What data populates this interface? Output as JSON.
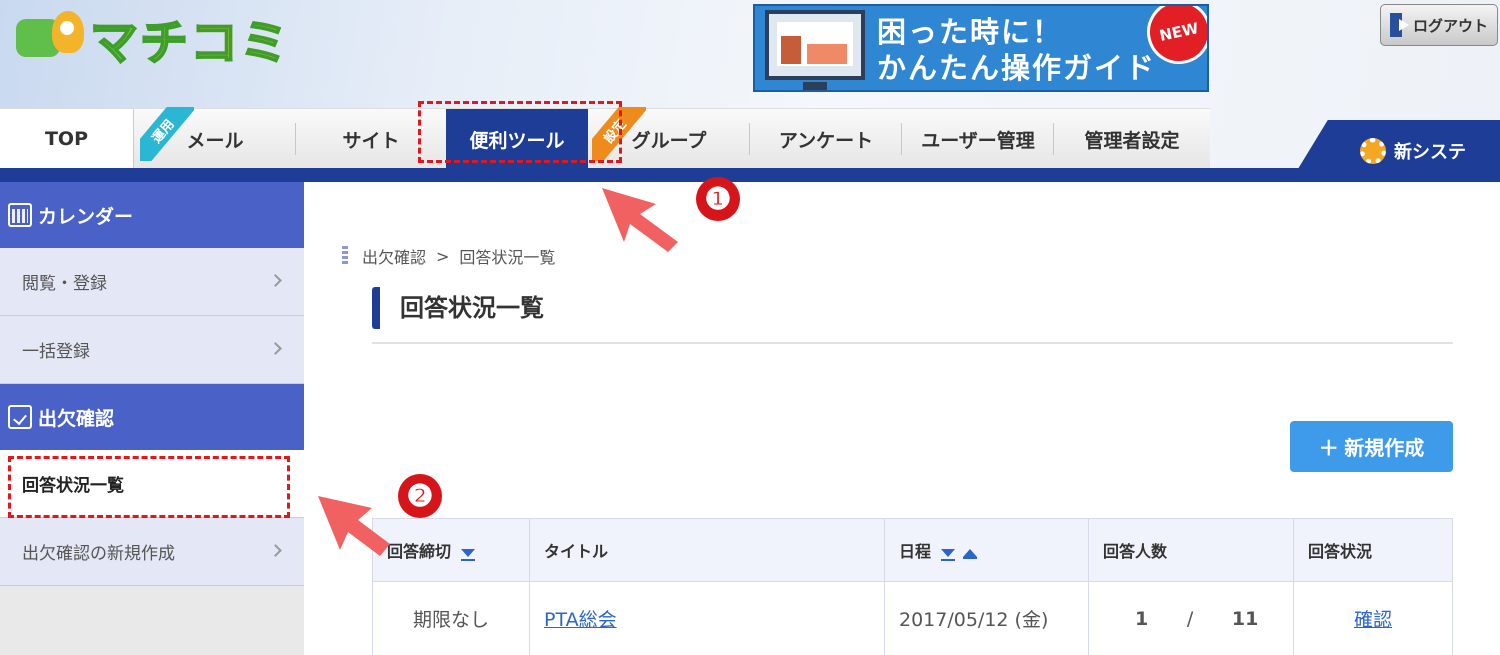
{
  "header": {
    "logo_text": "マチコミ",
    "banner": {
      "line1": "困った時に！",
      "line2": "かんたん操作ガイド",
      "badge": "NEW"
    },
    "logout_label": "ログアウト",
    "new_system_label": "新システ"
  },
  "nav": {
    "tabs": [
      {
        "label": "TOP"
      },
      {
        "label": "メール",
        "ribbon": "運用"
      },
      {
        "label": "サイト"
      },
      {
        "label": "便利ツール",
        "active": true
      },
      {
        "label": "グループ",
        "ribbon": "設定"
      },
      {
        "label": "アンケート"
      },
      {
        "label": "ユーザー管理"
      },
      {
        "label": "管理者設定"
      }
    ]
  },
  "sidebar": {
    "sections": [
      {
        "title": "カレンダー",
        "items": [
          {
            "label": "閲覧・登録"
          },
          {
            "label": "一括登録"
          }
        ]
      },
      {
        "title": "出欠確認",
        "items": [
          {
            "label": "回答状況一覧"
          },
          {
            "label": "出欠確認の新規作成"
          }
        ]
      }
    ]
  },
  "main": {
    "breadcrumb": {
      "parent": "出欠確認",
      "separator": ">",
      "current": "回答状況一覧"
    },
    "page_title": "回答状況一覧",
    "new_button": "＋ 新規作成",
    "table": {
      "headers": [
        "回答締切",
        "タイトル",
        "日程",
        "回答人数",
        "回答状況"
      ],
      "rows": [
        {
          "deadline": "期限なし",
          "title": "PTA総会",
          "date": "2017/05/12 (金)",
          "answered": "1",
          "slash": "/",
          "total": "11",
          "status": "確認"
        }
      ]
    }
  },
  "annotations": {
    "step1": "❶",
    "step2": "❷"
  },
  "colors": {
    "nav_active": "#1e3d96",
    "sidebar_header": "#4a62c8",
    "button": "#3d9be9",
    "annotation_red": "#e0181e"
  }
}
